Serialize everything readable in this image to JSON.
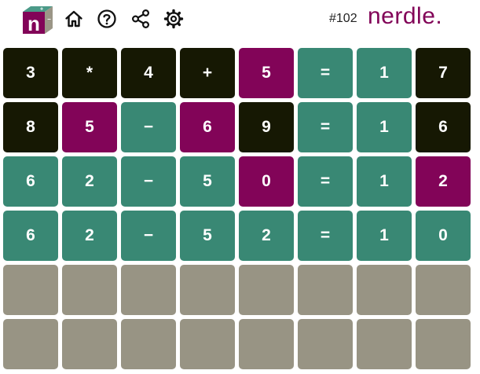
{
  "header": {
    "logo_letter": "n",
    "game_number": "#102",
    "brand_name": "nerdle.",
    "icons": [
      "home-icon",
      "help-icon",
      "share-icon",
      "settings-icon"
    ]
  },
  "colors": {
    "correct": "#398874",
    "present": "#820458",
    "absent": "#161803",
    "empty": "#989484",
    "brand": "#820458"
  },
  "board": {
    "rows": [
      [
        {
          "ch": "3",
          "state": "absent"
        },
        {
          "ch": "*",
          "state": "absent"
        },
        {
          "ch": "4",
          "state": "absent"
        },
        {
          "ch": "+",
          "state": "absent"
        },
        {
          "ch": "5",
          "state": "present"
        },
        {
          "ch": "=",
          "state": "correct"
        },
        {
          "ch": "1",
          "state": "correct"
        },
        {
          "ch": "7",
          "state": "absent"
        }
      ],
      [
        {
          "ch": "8",
          "state": "absent"
        },
        {
          "ch": "5",
          "state": "present"
        },
        {
          "ch": "−",
          "state": "correct"
        },
        {
          "ch": "6",
          "state": "present"
        },
        {
          "ch": "9",
          "state": "absent"
        },
        {
          "ch": "=",
          "state": "correct"
        },
        {
          "ch": "1",
          "state": "correct"
        },
        {
          "ch": "6",
          "state": "absent"
        }
      ],
      [
        {
          "ch": "6",
          "state": "correct"
        },
        {
          "ch": "2",
          "state": "correct"
        },
        {
          "ch": "−",
          "state": "correct"
        },
        {
          "ch": "5",
          "state": "correct"
        },
        {
          "ch": "0",
          "state": "present"
        },
        {
          "ch": "=",
          "state": "correct"
        },
        {
          "ch": "1",
          "state": "correct"
        },
        {
          "ch": "2",
          "state": "present"
        }
      ],
      [
        {
          "ch": "6",
          "state": "correct"
        },
        {
          "ch": "2",
          "state": "correct"
        },
        {
          "ch": "−",
          "state": "correct"
        },
        {
          "ch": "5",
          "state": "correct"
        },
        {
          "ch": "2",
          "state": "correct"
        },
        {
          "ch": "=",
          "state": "correct"
        },
        {
          "ch": "1",
          "state": "correct"
        },
        {
          "ch": "0",
          "state": "correct"
        }
      ],
      [
        {
          "ch": "",
          "state": "empty"
        },
        {
          "ch": "",
          "state": "empty"
        },
        {
          "ch": "",
          "state": "empty"
        },
        {
          "ch": "",
          "state": "empty"
        },
        {
          "ch": "",
          "state": "empty"
        },
        {
          "ch": "",
          "state": "empty"
        },
        {
          "ch": "",
          "state": "empty"
        },
        {
          "ch": "",
          "state": "empty"
        }
      ],
      [
        {
          "ch": "",
          "state": "empty"
        },
        {
          "ch": "",
          "state": "empty"
        },
        {
          "ch": "",
          "state": "empty"
        },
        {
          "ch": "",
          "state": "empty"
        },
        {
          "ch": "",
          "state": "empty"
        },
        {
          "ch": "",
          "state": "empty"
        },
        {
          "ch": "",
          "state": "empty"
        },
        {
          "ch": "",
          "state": "empty"
        }
      ]
    ]
  }
}
